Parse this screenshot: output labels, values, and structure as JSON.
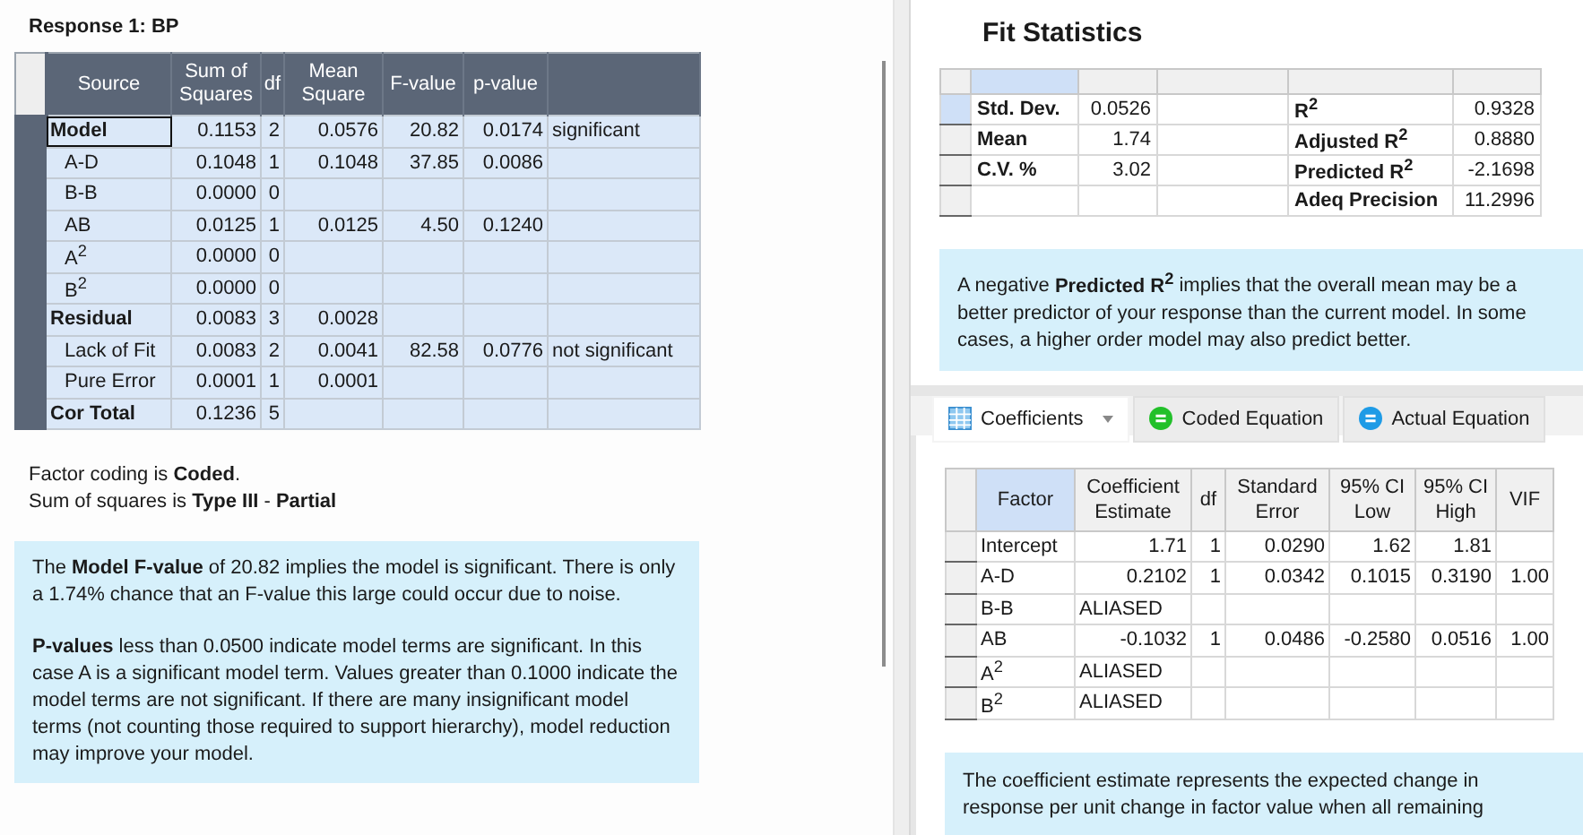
{
  "left": {
    "title": "Response 1: BP",
    "anova": {
      "columns": [
        "Source",
        "Sum of Squares",
        "df",
        "Mean Square",
        "F-value",
        "p-value"
      ],
      "rows": [
        {
          "kind": "group",
          "selected": true,
          "cells": [
            "Model",
            "0.1153",
            "2",
            "0.0576",
            "20.82",
            "0.0174",
            "significant"
          ]
        },
        {
          "kind": "term",
          "selected": false,
          "cells": [
            "A-D",
            "0.1048",
            "1",
            "0.1048",
            "37.85",
            "0.0086"
          ]
        },
        {
          "kind": "term",
          "selected": false,
          "cells": [
            "B-B",
            "0.0000",
            "0"
          ]
        },
        {
          "kind": "term",
          "selected": false,
          "cells": [
            "AB",
            "0.0125",
            "1",
            "0.0125",
            "4.50",
            "0.1240"
          ]
        },
        {
          "kind": "term",
          "selected": false,
          "cells": [
            "A$^{2}$",
            "0.0000",
            "0"
          ]
        },
        {
          "kind": "term",
          "selected": false,
          "cells": [
            "B$^{2}$",
            "0.0000",
            "0"
          ]
        },
        {
          "kind": "group",
          "selected": false,
          "cells": [
            "Residual",
            "0.0083",
            "3",
            "0.0028"
          ]
        },
        {
          "kind": "term",
          "selected": false,
          "cells": [
            "Lack of Fit",
            "0.0083",
            "2",
            "0.0041",
            "82.58",
            "0.0776",
            "not significant"
          ]
        },
        {
          "kind": "term",
          "selected": false,
          "cells": [
            "Pure Error",
            "0.0001",
            "1",
            "0.0001"
          ]
        },
        {
          "kind": "group",
          "selected": false,
          "cells": [
            "Cor Total",
            "0.1236",
            "5"
          ]
        }
      ]
    },
    "notes": [
      "Factor coding is **Coded**.",
      "Sum of squares is **Type III** - **Partial**"
    ],
    "info": [
      "The **Model F-value** of 20.82 implies the model is significant. There is only a 1.74% chance that an F-value this large could occur due to noise.",
      "**P-values** less than 0.0500 indicate model terms are significant. In this case A is a significant model term. Values greater than 0.1000 indicate the model terms are not significant. If there are many insignificant model terms (not counting those required to support hierarchy), model reduction may improve your model."
    ]
  },
  "right": {
    "title": "Fit Statistics",
    "fit": {
      "rows": [
        {
          "selected": true,
          "cells": [
            "Std. Dev.",
            "0.0526",
            "",
            "R$^{2}$",
            "0.9328"
          ]
        },
        {
          "selected": false,
          "cells": [
            "Mean",
            "1.74",
            "",
            "Adjusted R$^{2}$",
            "0.8880"
          ]
        },
        {
          "selected": false,
          "cells": [
            "C.V. %",
            "3.02",
            "",
            "Predicted R$^{2}$",
            "-2.1698"
          ]
        },
        {
          "selected": false,
          "cells": [
            "",
            "",
            "",
            "Adeq Precision",
            "11.2996"
          ]
        }
      ]
    },
    "fit_info": "A negative **Predicted R$^{2}$** implies that the overall mean may be a better predictor of your response than the current model. In some cases, a higher order model may also predict better.",
    "tabs": [
      {
        "label": "Coefficients",
        "kind": "table",
        "selected": true
      },
      {
        "label": "Coded Equation",
        "kind": "equation",
        "color": "#22c02a",
        "selected": false
      },
      {
        "label": "Actual Equation",
        "kind": "equation",
        "color": "#1e9be6",
        "selected": false
      }
    ],
    "coefficients": {
      "columns": [
        "Factor",
        "Coefficient Estimate",
        "df",
        "Standard Error",
        "95% CI Low",
        "95% CI High",
        "VIF"
      ],
      "rows": [
        {
          "cells": [
            "Intercept",
            "1.71",
            "1",
            "0.0290",
            "1.62",
            "1.81"
          ]
        },
        {
          "cells": [
            "A-D",
            "0.2102",
            "1",
            "0.0342",
            "0.1015",
            "0.3190",
            "1.00"
          ]
        },
        {
          "cells": [
            "B-B",
            "ALIASED"
          ]
        },
        {
          "cells": [
            "AB",
            "-0.1032",
            "1",
            "0.0486",
            "-0.2580",
            "0.0516",
            "1.00"
          ]
        },
        {
          "cells": [
            "A$^{2}$",
            "ALIASED"
          ]
        },
        {
          "cells": [
            "B$^{2}$",
            "ALIASED"
          ]
        }
      ]
    },
    "coef_info": "The coefficient estimate represents the expected change in response per unit change in factor value when all remaining"
  }
}
